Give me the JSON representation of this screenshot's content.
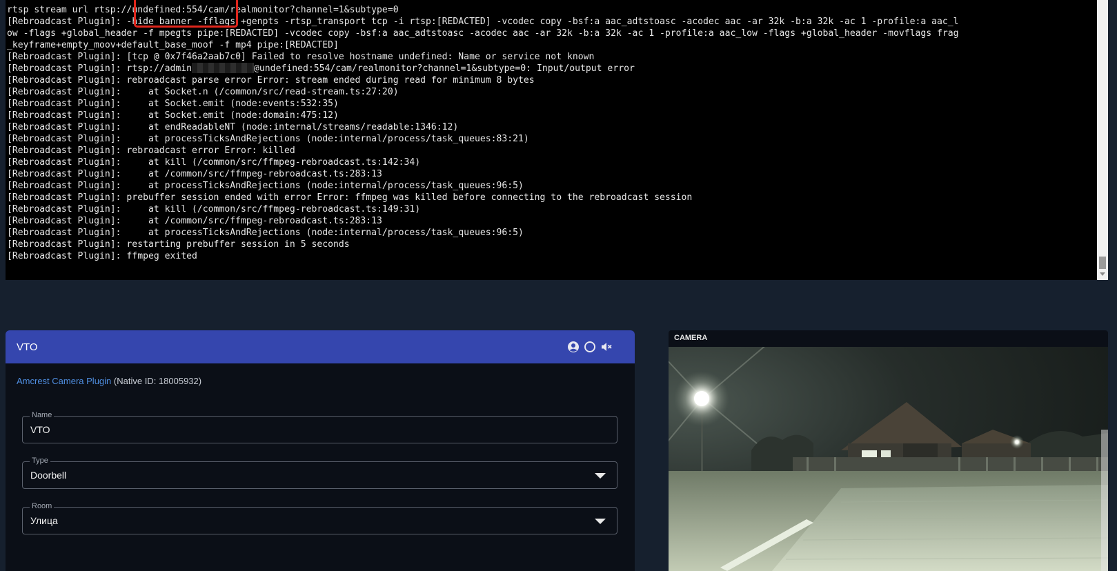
{
  "terminal": {
    "lines": [
      "rtsp stream url rtsp://undefined:554/cam/realmonitor?channel=1&subtype=0",
      "[Rebroadcast Plugin]: -hide_banner -fflags +genpts -rtsp_transport tcp -i rtsp:[REDACTED] -vcodec copy -bsf:a aac_adtstoasc -acodec aac -ar 32k -b:a 32k -ac 1 -profile:a aac_l",
      "ow -flags +global_header -f mpegts pipe:[REDACTED] -vcodec copy -bsf:a aac_adtstoasc -acodec aac -ar 32k -b:a 32k -ac 1 -profile:a aac_low -flags +global_header -movflags frag",
      "_keyframe+empty_moov+default_base_moof -f mp4 pipe:[REDACTED]",
      "[Rebroadcast Plugin]: [tcp @ 0x7f46a2aab7c0] Failed to resolve hostname undefined: Name or service not known",
      "[Rebroadcast Plugin]: rtsp://admin",
      "[Rebroadcast Plugin]: rebroadcast parse error Error: stream ended during read for minimum 8 bytes",
      "[Rebroadcast Plugin]:     at Socket.n (/common/src/read-stream.ts:27:20)",
      "[Rebroadcast Plugin]:     at Socket.emit (node:events:532:35)",
      "[Rebroadcast Plugin]:     at Socket.emit (node:domain:475:12)",
      "[Rebroadcast Plugin]:     at endReadableNT (node:internal/streams/readable:1346:12)",
      "[Rebroadcast Plugin]:     at processTicksAndRejections (node:internal/process/task_queues:83:21)",
      "[Rebroadcast Plugin]: rebroadcast error Error: killed",
      "[Rebroadcast Plugin]:     at kill (/common/src/ffmpeg-rebroadcast.ts:142:34)",
      "[Rebroadcast Plugin]:     at /common/src/ffmpeg-rebroadcast.ts:283:13",
      "[Rebroadcast Plugin]:     at processTicksAndRejections (node:internal/process/task_queues:96:5)",
      "[Rebroadcast Plugin]: prebuffer session ended with error Error: ffmpeg was killed before connecting to the rebroadcast session",
      "[Rebroadcast Plugin]:     at kill (/common/src/ffmpeg-rebroadcast.ts:149:31)",
      "[Rebroadcast Plugin]:     at /common/src/ffmpeg-rebroadcast.ts:283:13",
      "[Rebroadcast Plugin]:     at processTicksAndRejections (node:internal/process/task_queues:96:5)",
      "[Rebroadcast Plugin]: restarting prebuffer session in 5 seconds",
      "[Rebroadcast Plugin]: ffmpeg exited"
    ],
    "line5_suffix": "@undefined:554/cam/realmonitor?channel=1&subtype=0: Input/output error",
    "highlight_color": "#e0261c"
  },
  "device": {
    "title": "VTO",
    "header_icons": [
      "account-circle-icon",
      "circle-outline-icon",
      "volume-off-icon"
    ],
    "header_color": "#3546ae",
    "plugin_link": "Amcrest Camera Plugin",
    "native_id": "(Native ID: 18005932)",
    "fields": {
      "name": {
        "label": "Name",
        "value": "VTO"
      },
      "type": {
        "label": "Type",
        "value": "Doorbell"
      },
      "room": {
        "label": "Room",
        "value": "Улица"
      }
    }
  },
  "camera": {
    "label": "CAMERA"
  }
}
